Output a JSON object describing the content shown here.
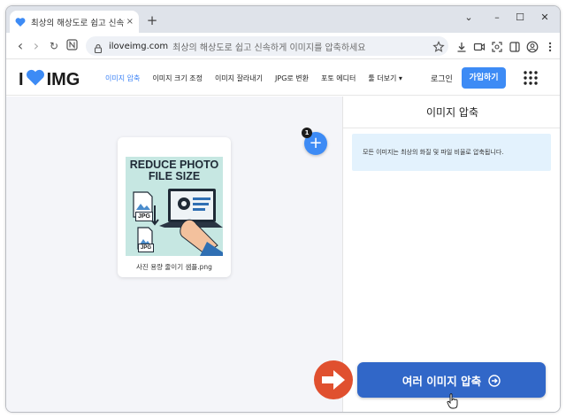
{
  "browser": {
    "tab_title": "최상의 해상도로 쉽고 신속하게",
    "tab_close": "×",
    "new_tab": "+",
    "url_domain": "iloveimg.com",
    "url_rest": "최상의 해상도로 쉽고 신속하게 이미지를 압축하세요",
    "window_controls": {
      "collapse": "⌄",
      "minimize": "–",
      "maximize": "☐",
      "close": "✕"
    },
    "nav": {
      "back": "‹",
      "forward": "›",
      "reload": "↻"
    }
  },
  "site": {
    "logo_left": "I",
    "logo_right": "IMG",
    "menu": [
      {
        "label": "이미지 압축",
        "active": true
      },
      {
        "label": "이미지 크기 조정",
        "active": false
      },
      {
        "label": "이미지 잘라내기",
        "active": false
      },
      {
        "label": "JPG로 변환",
        "active": false
      },
      {
        "label": "포토 에디터",
        "active": false
      },
      {
        "label": "툴 더보기 ▾",
        "active": false
      }
    ],
    "login": "로그인",
    "signup": "가입하기"
  },
  "workspace": {
    "file_name": "사진 용량 줄이기 샘플.png",
    "thumbnail_title_line1": "REDUCE PHOTO",
    "thumbnail_title_line2": "FILE SIZE",
    "thumbnail_badge_1": "JPG",
    "thumbnail_badge_2": "JPG",
    "add_button": "+",
    "file_count": "1"
  },
  "panel": {
    "title": "이미지 압축",
    "info": "모든 이미지는 최상의 화질 및 파일 비율로 압축됩니다.",
    "compress_button": "여러 이미지 압축"
  },
  "colors": {
    "accent": "#3d8bf5",
    "compress_button": "#3167c8",
    "info_bg": "#e3f2fd",
    "annotation_arrow": "#e0502f"
  }
}
